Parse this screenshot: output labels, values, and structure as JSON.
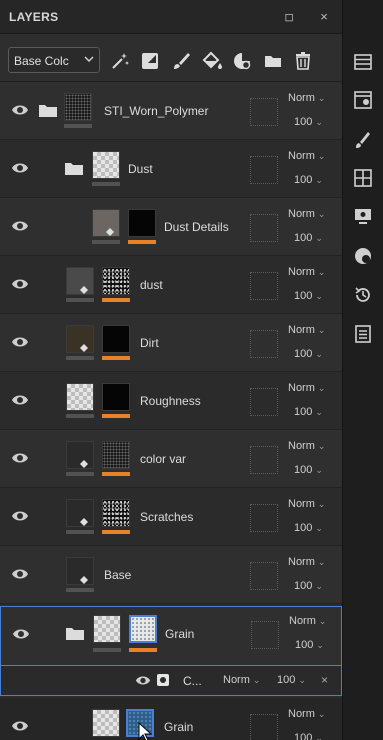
{
  "panel": {
    "title": "LAYERS",
    "window_buttons": {
      "restore": "◽",
      "close": "×"
    }
  },
  "toolbar": {
    "channel_dropdown": "Base Colc",
    "tools": [
      "magic-wand-icon",
      "smart-material-icon",
      "paint-brush-icon",
      "fill-bucket-icon",
      "smart-mask-icon",
      "folder-icon",
      "trash-icon"
    ]
  },
  "layers": [
    {
      "name": "STI_Worn_Polymer",
      "blend": "Norm",
      "opacity": "100",
      "type": "folder"
    },
    {
      "name": "Dust",
      "blend": "Norm",
      "opacity": "100",
      "type": "folder"
    },
    {
      "name": "Dust Details",
      "blend": "Norm",
      "opacity": "100",
      "type": "fill"
    },
    {
      "name": "dust",
      "blend": "Norm",
      "opacity": "100",
      "type": "fill"
    },
    {
      "name": "Dirt",
      "blend": "Norm",
      "opacity": "100",
      "type": "fill"
    },
    {
      "name": "Roughness",
      "blend": "Norm",
      "opacity": "100",
      "type": "fill"
    },
    {
      "name": "color var",
      "blend": "Norm",
      "opacity": "100",
      "type": "fill"
    },
    {
      "name": "Scratches",
      "blend": "Norm",
      "opacity": "100",
      "type": "fill"
    },
    {
      "name": "Base",
      "blend": "Norm",
      "opacity": "100",
      "type": "fill"
    },
    {
      "name": "Grain",
      "blend": "Norm",
      "opacity": "100",
      "type": "folder-selected"
    },
    {
      "name": "Grain",
      "blend": "Norm",
      "opacity": "100",
      "type": "fill"
    }
  ],
  "selected_sub": {
    "label": "C...",
    "blend": "Norm",
    "opacity": "100",
    "remove": "×"
  },
  "sidebar_icons": [
    "layers-list-icon",
    "texture-set-icon",
    "brush-settings-icon",
    "grid-icon",
    "display-icon",
    "shader-icon",
    "history-icon",
    "log-icon"
  ],
  "colors": {
    "accent": "#4a7fd6",
    "mask_bar": "#e8822a",
    "panel": "#2c2c2c"
  }
}
